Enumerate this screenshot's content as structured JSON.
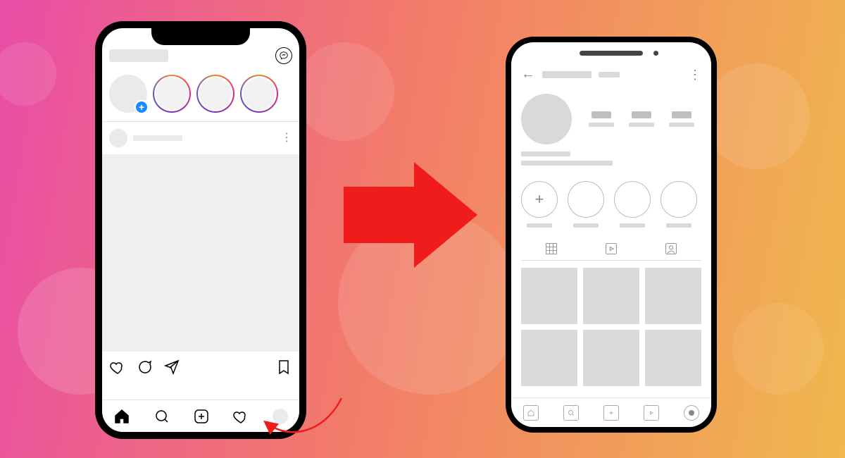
{
  "diagram": {
    "meaning": "Navigate from feed to profile",
    "arrow_color": "#f01c1c",
    "pointer_color": "#f01c1c"
  },
  "phone_a": {
    "screen": "feed",
    "header": {
      "dm_icon": "messenger-icon"
    },
    "stories": {
      "own": {
        "add_glyph": "+"
      },
      "ring_count": 3
    },
    "post": {
      "more_glyph": "⋮",
      "actions": [
        "like",
        "comment",
        "share",
        "save"
      ]
    },
    "nav": [
      "home",
      "search",
      "create",
      "activity",
      "profile"
    ]
  },
  "phone_b": {
    "screen": "profile",
    "back_glyph": "←",
    "menu_glyph": "⋮",
    "highlights": {
      "add_glyph": "+",
      "count": 4
    },
    "tabs": [
      "grid",
      "reels",
      "tagged"
    ],
    "grid_count": 6,
    "nav": [
      "home",
      "search",
      "create",
      "reels",
      "profile"
    ]
  }
}
